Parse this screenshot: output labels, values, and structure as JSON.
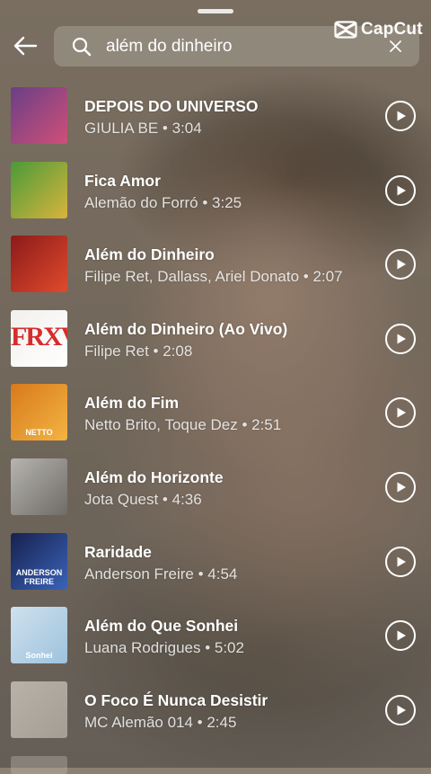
{
  "watermark": {
    "label": "CapCut",
    "icon": "capcut-logo-icon"
  },
  "search": {
    "query": "além do dinheiro",
    "placeholder": "",
    "icon": "search-icon",
    "clear_icon": "close-icon"
  },
  "nav": {
    "back_icon": "arrow-left-icon"
  },
  "tracks": [
    {
      "title": "DEPOIS DO UNIVERSO",
      "meta": "GIULIA BE • 3:04",
      "thumb_label": "",
      "thumb_colors": [
        "#6a3f86",
        "#d04f78"
      ]
    },
    {
      "title": "Fica Amor",
      "meta": "Alemão do Forró • 3:25",
      "thumb_label": "",
      "thumb_colors": [
        "#4b9a3a",
        "#d8b43c"
      ]
    },
    {
      "title": "Além do Dinheiro",
      "meta": "Filipe Ret, Dallass, Ariel Donato • 2:07",
      "thumb_label": "",
      "thumb_colors": [
        "#8c1a1a",
        "#e04a2c"
      ]
    },
    {
      "title": "Além do Dinheiro (Ao Vivo)",
      "meta": "Filipe Ret • 2:08",
      "thumb_label": "FRXV",
      "thumb_colors": [
        "#f2f0ec",
        "#ffffff"
      ]
    },
    {
      "title": "Além do Fim",
      "meta": "Netto Brito, Toque Dez • 2:51",
      "thumb_label": "NETTO",
      "thumb_colors": [
        "#d87a1c",
        "#f3b443"
      ]
    },
    {
      "title": "Além do Horizonte",
      "meta": "Jota Quest • 4:36",
      "thumb_label": "",
      "thumb_colors": [
        "#b6b4b0",
        "#6f6c68"
      ]
    },
    {
      "title": "Raridade",
      "meta": "Anderson Freire • 4:54",
      "thumb_label": "ANDERSON FREIRE",
      "thumb_colors": [
        "#17214f",
        "#3a63b8"
      ]
    },
    {
      "title": "Além do Que Sonhei",
      "meta": "Luana Rodrigues • 5:02",
      "thumb_label": "Sonhei",
      "thumb_colors": [
        "#cfe1ee",
        "#9ec2dd"
      ]
    },
    {
      "title": "O Foco É Nunca Desistir",
      "meta": "MC Alemão 014 • 2:45",
      "thumb_label": "",
      "thumb_colors": [
        "#b9b2a8",
        "#a59d93"
      ]
    }
  ],
  "play_icon": "play-icon"
}
